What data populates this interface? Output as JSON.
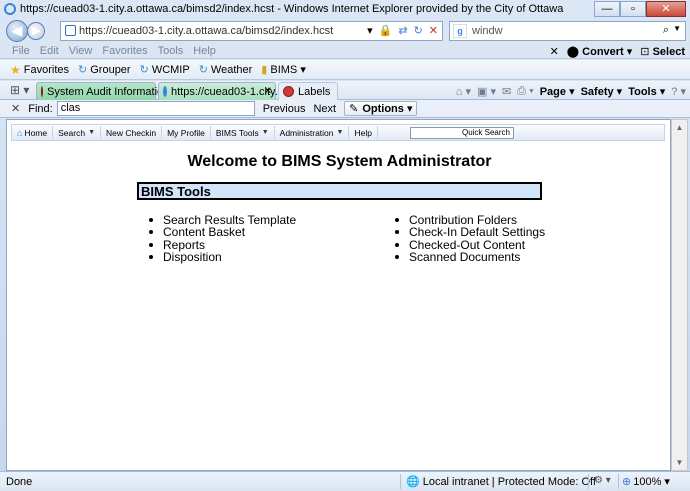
{
  "window": {
    "title": "https://cuead03-1.city.a.ottawa.ca/bimsd2/index.hcst - Windows Internet Explorer provided by the City of Ottawa",
    "min": "—",
    "max": "▫",
    "close": "✕"
  },
  "address": {
    "url": "https://cuead03-1.city.a.ottawa.ca/bimsd2/index.hcst"
  },
  "search": {
    "value": "windw"
  },
  "menu": {
    "items": [
      "File",
      "Edit",
      "View",
      "Favorites",
      "Tools",
      "Help"
    ],
    "convert": "Convert",
    "select": "Select"
  },
  "favorites": {
    "label": "Favorites",
    "items": [
      "Grouper",
      "WCMIP",
      "Weather",
      "BIMS"
    ]
  },
  "tabs": [
    {
      "label": "System Audit Information"
    },
    {
      "label": "https://cuead03-1.city...."
    },
    {
      "label": "Labels"
    }
  ],
  "commandbar": {
    "page": "Page",
    "safety": "Safety",
    "tools": "Tools"
  },
  "find": {
    "label": "Find:",
    "value": "clas",
    "previous": "Previous",
    "next": "Next",
    "options": "Options"
  },
  "sitenav": {
    "items": [
      "Home",
      "Search",
      "New Checkin",
      "My Profile",
      "BIMS Tools",
      "Administration",
      "Help"
    ],
    "quick_search": "Quick Search"
  },
  "content": {
    "welcome": "Welcome to BIMS System Administrator",
    "section_title": "BIMS Tools",
    "left_links": [
      "Search Results Template",
      "Content Basket",
      "Reports",
      "Disposition"
    ],
    "right_links": [
      "Contribution Folders",
      "Check-In Default Settings",
      "Checked-Out Content",
      "Scanned Documents"
    ]
  },
  "status": {
    "text": "Done",
    "zone": "Local intranet | Protected Mode: Off",
    "zoom": "100%"
  }
}
